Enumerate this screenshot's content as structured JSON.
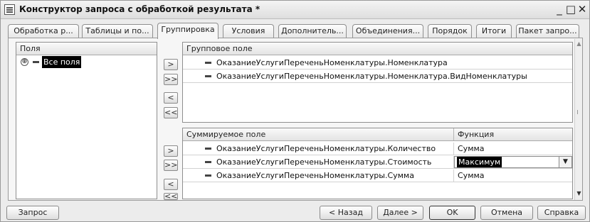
{
  "window": {
    "title": "Конструктор запроса с обработкой результата *",
    "minimize": "_",
    "maximize": "□",
    "close": "✕"
  },
  "tabs": [
    {
      "label": "Обработка р...",
      "active": false
    },
    {
      "label": "Таблицы и по...",
      "active": false
    },
    {
      "label": "Группировка",
      "active": true
    },
    {
      "label": "Условия",
      "active": false
    },
    {
      "label": "Дополнитель...",
      "active": false
    },
    {
      "label": "Объединения...",
      "active": false
    },
    {
      "label": "Порядок",
      "active": false
    },
    {
      "label": "Итоги",
      "active": false
    },
    {
      "label": "Пакет запро...",
      "active": false
    }
  ],
  "fields_panel": {
    "header": "Поля",
    "items": [
      {
        "label": "Все поля",
        "expander": "⊕"
      }
    ]
  },
  "move_buttons": {
    "add": ">",
    "add_all": ">>",
    "remove": "<",
    "remove_all": "<<"
  },
  "group_panel": {
    "header": "Групповое поле",
    "rows": [
      "ОказаниеУслугиПереченьНоменклатуры.Номенклатура",
      "ОказаниеУслугиПереченьНоменклатуры.Номенклатура.ВидНоменклатуры"
    ]
  },
  "sum_panel": {
    "headers": {
      "field": "Суммируемое поле",
      "function": "Функция"
    },
    "rows": [
      {
        "field": "ОказаниеУслугиПереченьНоменклатуры.Количество",
        "function": "Сумма"
      },
      {
        "field": "ОказаниеУслугиПереченьНоменклатуры.Стоимость",
        "function": "Максимум"
      },
      {
        "field": "ОказаниеУслугиПереченьНоменклатуры.Сумма",
        "function": "Сумма"
      }
    ]
  },
  "footer": {
    "query": "Запрос",
    "back": "< Назад",
    "next": "Далее >",
    "ok": "OK",
    "cancel": "Отмена",
    "help": "Справка"
  },
  "icons": {
    "scroll_up": "▲",
    "scroll_down": "▼",
    "dropdown": "▼"
  }
}
